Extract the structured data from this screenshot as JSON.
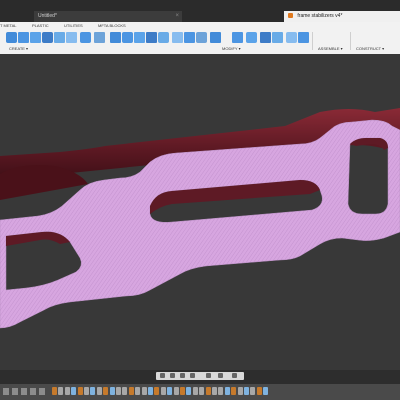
{
  "tabs": [
    {
      "label": "Untitled*",
      "active": false
    },
    {
      "label": "frame stabilizers v4*",
      "active": true
    }
  ],
  "ribbon": {
    "tabs": [
      "T METAL",
      "PLASTIC",
      "UTILITIES",
      "MFTA BLOCKS"
    ],
    "groups": [
      "CREATE ▾",
      "MODIFY ▾",
      "ASSEMBLE ▾",
      "CONSTRUCT ▾"
    ],
    "tool_icons": [
      "extrude-icon",
      "revolve-icon",
      "hole-icon",
      "cylinder-icon",
      "pipe-icon",
      "sweep-icon",
      "coil-icon",
      "pyramid-icon",
      "fillet-icon",
      "chamfer-icon",
      "shell-icon",
      "draft-icon",
      "scale-icon",
      "combine-icon",
      "move-icon",
      "align-icon",
      "offset-plane-icon",
      "new-component-icon",
      "joint-icon",
      "as-built-joint-icon",
      "plane-icon",
      "axis-icon",
      "point-icon"
    ]
  },
  "colors": {
    "body_side": "#6b1f2b",
    "body_cap": "#d7a6e0",
    "viewport_bg": "#383838",
    "ribbon_bg": "#f2f2f2",
    "tab_active_bg": "#f0f0f0"
  },
  "navbar": {
    "icons": [
      "orbit-icon",
      "pan-icon",
      "zoom-icon",
      "fit-icon",
      "display-icon",
      "grid-icon",
      "viewport-icon"
    ]
  },
  "timeline": {
    "controls": [
      "first-icon",
      "prev-icon",
      "play-icon",
      "next-icon",
      "last-icon"
    ]
  }
}
